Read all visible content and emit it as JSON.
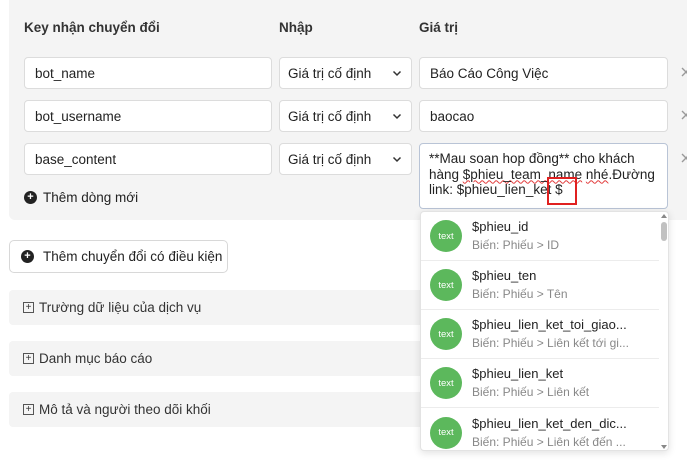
{
  "headers": {
    "key": "Key nhận chuyển đổi",
    "input": "Nhập",
    "value": "Giá trị"
  },
  "rows": [
    {
      "key": "bot_name",
      "input": "Giá trị cố định",
      "value": "Báo Cáo Công Việc"
    },
    {
      "key": "bot_username",
      "input": "Giá trị cố định",
      "value": "baocao"
    },
    {
      "key": "base_content",
      "input": "Giá trị cố định"
    }
  ],
  "textarea": {
    "part1": "**Mau soan hop đồng** cho khách hàng ",
    "part2": "$phieu_team_name",
    "part3": " ",
    "part4": "nhé",
    "part5": ".Đường link: $phieu_lien_ket",
    "part6": " $"
  },
  "add_row_label": "Thêm dòng mới",
  "conditional_button_label": "Thêm chuyển đổi có điều kiện",
  "sections": [
    "Trường dữ liệu của dịch vụ",
    "Danh mục báo cáo",
    "Mô tả và người theo dõi khối"
  ],
  "dropdown": {
    "badge_label": "text",
    "items": [
      {
        "name": "$phieu_id",
        "path": "Biến: Phiếu > ID"
      },
      {
        "name": "$phieu_ten",
        "path": "Biến: Phiếu > Tên"
      },
      {
        "name": "$phieu_lien_ket_toi_giao...",
        "path": "Biến: Phiếu > Liên kết tới gi..."
      },
      {
        "name": "$phieu_lien_ket",
        "path": "Biến: Phiếu > Liên kết"
      },
      {
        "name": "$phieu_lien_ket_den_dic...",
        "path": "Biến: Phiếu > Liên kết đến ..."
      }
    ]
  },
  "colors": {
    "badge_green": "#5cb85c",
    "highlight_red": "#e02020",
    "panel_bg": "#f4f4f4"
  }
}
